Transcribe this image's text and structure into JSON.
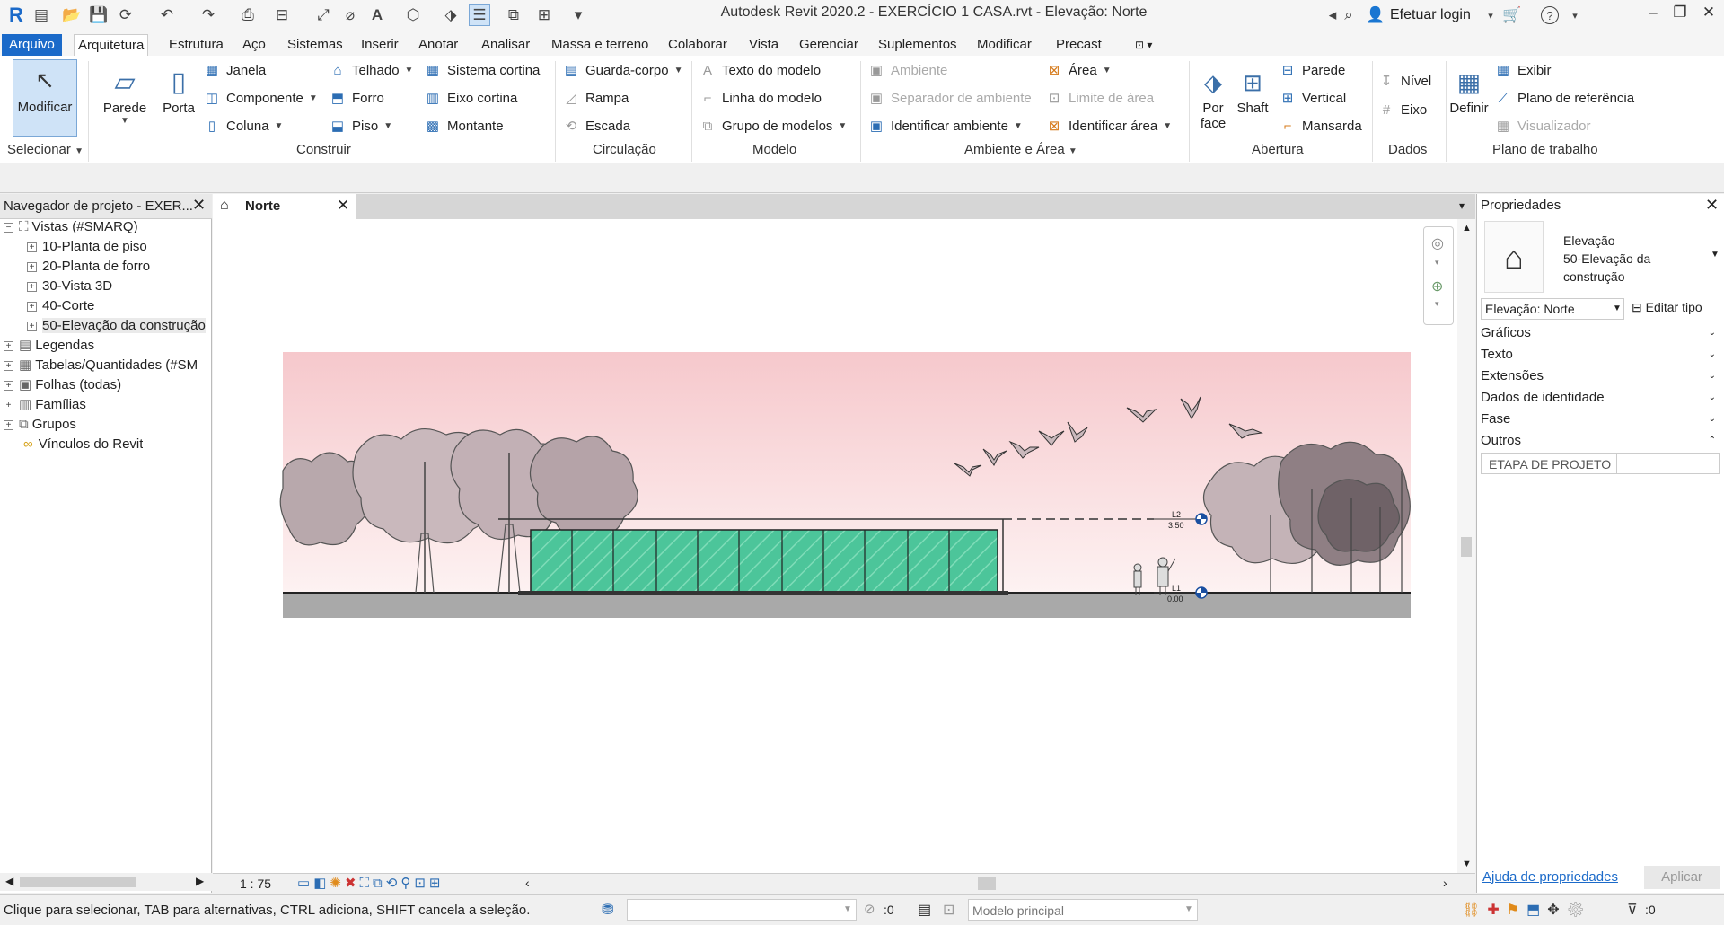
{
  "title_bar": {
    "app_title": "Autodesk Revit 2020.2 - EXERCÍCIO 1 CASA.rvt - Elevação: Norte",
    "login_label": "Efetuar login",
    "help_icon": "help-icon"
  },
  "menu": {
    "file": "Arquivo",
    "tabs": [
      "Arquitetura",
      "Estrutura",
      "Aço",
      "Sistemas",
      "Inserir",
      "Anotar",
      "Analisar",
      "Massa e terreno",
      "Colaborar",
      "Vista",
      "Gerenciar",
      "Suplementos",
      "Modificar",
      "Precast"
    ]
  },
  "ribbon": {
    "modify": "Modificar",
    "select": "Selecionar",
    "build": {
      "label": "Construir",
      "parede": "Parede",
      "porta": "Porta",
      "janela": "Janela",
      "componente": "Componente",
      "coluna": "Coluna",
      "telhado": "Telhado",
      "forro": "Forro",
      "piso": "Piso",
      "sistema_cortina": "Sistema cortina",
      "eixo_cortina": "Eixo cortina",
      "montante": "Montante"
    },
    "circulation": {
      "label": "Circulação",
      "guarda_corpo": "Guarda-corpo",
      "rampa": "Rampa",
      "escada": "Escada"
    },
    "model": {
      "label": "Modelo",
      "texto_modelo": "Texto do modelo",
      "linha_modelo": "Linha do modelo",
      "grupo_modelos": "Grupo de modelos"
    },
    "room_area": {
      "label": "Ambiente e Área",
      "ambiente": "Ambiente",
      "separador": "Separador de ambiente",
      "identificar_ambiente": "Identificar ambiente",
      "area": "Área",
      "limite_area": "Limite de área",
      "identificar_area": "Identificar área"
    },
    "opening": {
      "label": "Abertura",
      "por_face_1": "Por",
      "por_face_2": "face",
      "shaft": "Shaft",
      "parede": "Parede",
      "vertical": "Vertical",
      "mansarda": "Mansarda"
    },
    "datum": {
      "label": "Dados",
      "nivel": "Nível",
      "eixo": "Eixo"
    },
    "workplane": {
      "label": "Plano de trabalho",
      "definir": "Definir",
      "exibir": "Exibir",
      "plano_referencia": "Plano de referência",
      "visualizador": "Visualizador"
    }
  },
  "browser": {
    "title": "Navegador de projeto - EXER...",
    "items": [
      {
        "label": "Vistas (#SMARQ)",
        "level": 0,
        "expanded": true
      },
      {
        "label": "10-Planta de piso",
        "level": 1
      },
      {
        "label": "20-Planta de forro",
        "level": 1
      },
      {
        "label": "30-Vista 3D",
        "level": 1
      },
      {
        "label": "40-Corte",
        "level": 1
      },
      {
        "label": "50-Elevação da construção",
        "level": 1
      },
      {
        "label": "Legendas",
        "level": 0
      },
      {
        "label": "Tabelas/Quantidades (#SM",
        "level": 0
      },
      {
        "label": "Folhas (todas)",
        "level": 0
      },
      {
        "label": "Famílias",
        "level": 0
      },
      {
        "label": "Grupos",
        "level": 0
      },
      {
        "label": "Vínculos do Revit",
        "level": 0
      }
    ]
  },
  "view": {
    "tab_label": "Norte",
    "scale": "1 : 75",
    "level_top_name": "L2",
    "level_top_value": "3.50",
    "level_bottom_name": "L1",
    "level_bottom_value": "0.00"
  },
  "properties": {
    "title": "Propriedades",
    "type_line1": "Elevação",
    "type_line2": "50-Elevação da",
    "type_line3": "construção",
    "selector": "Elevação: Norte",
    "edit_type": "Editar tipo",
    "groups": [
      "Gráficos",
      "Texto",
      "Extensões",
      "Dados de identidade",
      "Fase",
      "Outros"
    ],
    "param_name": "ETAPA DE PROJETO",
    "help_link": "Ajuda de propriedades",
    "apply": "Aplicar"
  },
  "status": {
    "message": "Clique para selecionar, TAB para alternativas, CTRL adiciona, SHIFT cancela a seleção.",
    "workset_count": ":0",
    "model": "Modelo principal",
    "filter_count": ":0"
  },
  "colors": {
    "accent": "#1b6ac9",
    "glass": "#4cc59a",
    "sky_top": "#f6c8cc"
  }
}
